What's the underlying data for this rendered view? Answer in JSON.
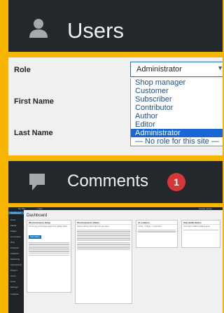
{
  "users_panel": {
    "title": "Users",
    "icon": "users-icon"
  },
  "profile_form": {
    "role_label": "Role",
    "first_name_label": "First Name",
    "last_name_label": "Last Name",
    "role_selected": "Administrator",
    "role_options": [
      "Shop manager",
      "Customer",
      "Subscriber",
      "Contributor",
      "Author",
      "Editor",
      "Administrator",
      "— No role for this site —"
    ],
    "highlighted_option": "Administrator"
  },
  "comments_panel": {
    "title": "Comments",
    "count": "1",
    "icon": "comment-icon"
  },
  "dashboard": {
    "page_title": "Dashboard",
    "admin_bar": {
      "site": "My Site",
      "new": "+ New",
      "howdy": "Howdy, admin"
    },
    "menu": [
      "Dashboard",
      "Posts",
      "Media",
      "Pages",
      "Comments",
      "Woo",
      "Products",
      "Analytics",
      "Marketing",
      "Appearance",
      "Plugins",
      "Users",
      "Tools",
      "Settings",
      "Collapse"
    ],
    "boxes": {
      "welcome": {
        "title": "WooCommerce Setup",
        "text": "You're only a few steps away from selling online.",
        "button": "Start selling"
      },
      "activity": {
        "title": "WooCommerce Status",
        "text": "Recent activity and orders for your store."
      },
      "glance": {
        "title": "At a Glance",
        "text": "1 Post · 1 Page · 1 Comment"
      },
      "events": {
        "title": "Site Health Status",
        "text": "Your site's health is looking good."
      },
      "news": {
        "title": "WordPress Events and News",
        "text": "Attend an upcoming event near you."
      }
    }
  },
  "colors": {
    "frame": "#f7b500",
    "header_bg": "#23282d",
    "accent": "#2271b1",
    "badge": "#d63638",
    "selected": "#1967d2"
  }
}
